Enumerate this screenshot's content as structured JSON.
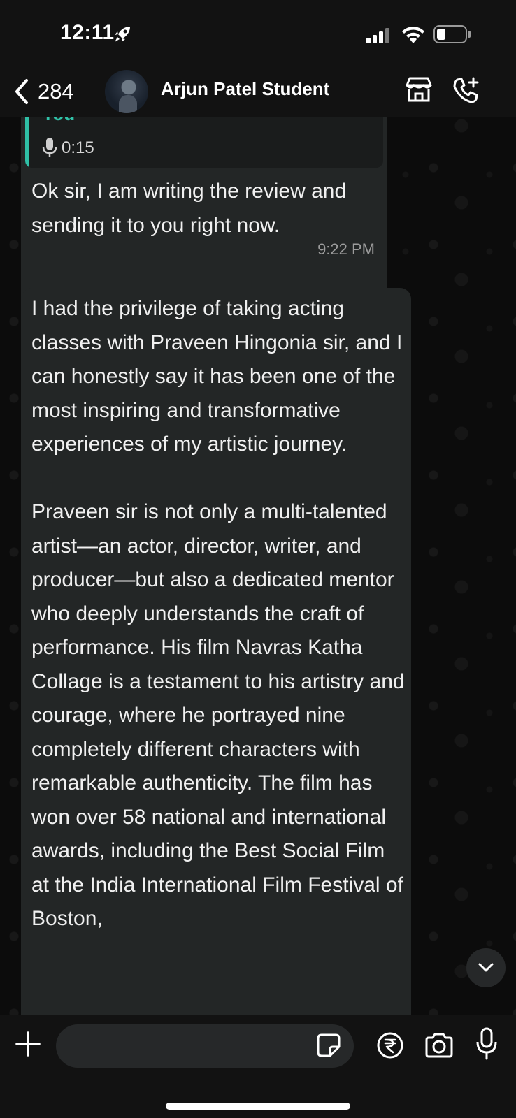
{
  "status_bar": {
    "time": "12:11",
    "icons": [
      "rocket-icon",
      "cellular-signal-icon",
      "wifi-icon",
      "battery-icon"
    ]
  },
  "header": {
    "back_count": "284",
    "contact_name": "Arjun Patel Student",
    "icons": [
      "chevron-left-icon",
      "store-icon",
      "add-call-icon"
    ]
  },
  "messages": [
    {
      "reply_author": "You",
      "reply_duration": "0:15",
      "text": "Ok sir, I am writing the review and sending it to you right now.",
      "time": "9:22 PM"
    },
    {
      "text": "I had the privilege of taking acting classes with Praveen Hingonia sir, and I can honestly say it has been one of the most inspiring and transformative experiences of my artistic journey.\n\nPraveen sir is not only a multi-talented artist—an actor, director, writer, and producer—but also a dedicated mentor who deeply understands the craft of performance. His film Navras Katha Collage is a testament to his artistry and courage, where he portrayed nine completely different characters with remarkable authenticity. The film has won over 58 national and international awards, including the Best Social Film at the India International Film Festival of Boston,"
    }
  ],
  "input_bar": {
    "placeholder": "",
    "icons": [
      "plus-icon",
      "sticker-icon",
      "rupee-icon",
      "camera-icon",
      "microphone-icon"
    ]
  },
  "colors": {
    "background": "#0c0c0c",
    "bubble": "#232626",
    "reply_accent": "#2fbfa6",
    "bars": "#121212"
  }
}
